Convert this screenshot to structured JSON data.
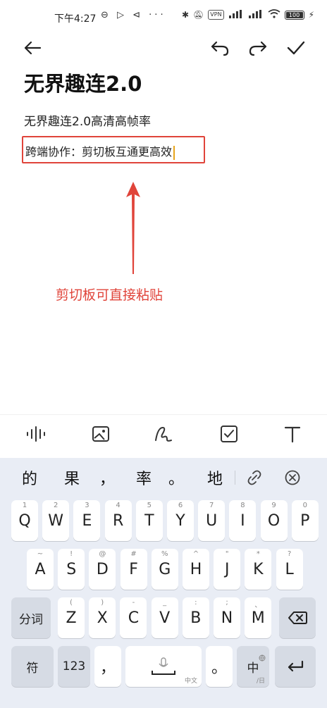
{
  "status_bar": {
    "time": "下午4:27",
    "vpn": "VPN",
    "battery": "100"
  },
  "note": {
    "title": "无界趣连2.0",
    "line1": "无界趣连2.0高清高帧率",
    "line2": "跨端协作：剪切板互通更高效",
    "annotation": "剪切板可直接粘贴"
  },
  "candidates": [
    "的",
    "果",
    "，",
    "率",
    "。",
    "地"
  ],
  "keyboard": {
    "row1": [
      {
        "k": "Q",
        "h": "1"
      },
      {
        "k": "W",
        "h": "2"
      },
      {
        "k": "E",
        "h": "3"
      },
      {
        "k": "R",
        "h": "4"
      },
      {
        "k": "T",
        "h": "5"
      },
      {
        "k": "Y",
        "h": "6"
      },
      {
        "k": "U",
        "h": "7"
      },
      {
        "k": "I",
        "h": "8"
      },
      {
        "k": "O",
        "h": "9"
      },
      {
        "k": "P",
        "h": "0"
      }
    ],
    "row2": [
      {
        "k": "A",
        "h": "~"
      },
      {
        "k": "S",
        "h": "!"
      },
      {
        "k": "D",
        "h": "@"
      },
      {
        "k": "F",
        "h": "#"
      },
      {
        "k": "G",
        "h": "%"
      },
      {
        "k": "H",
        "h": "^"
      },
      {
        "k": "J",
        "h": "\""
      },
      {
        "k": "K",
        "h": "*"
      },
      {
        "k": "L",
        "h": "?"
      }
    ],
    "row3": [
      {
        "k": "Z",
        "h": "("
      },
      {
        "k": "X",
        "h": ")"
      },
      {
        "k": "C",
        "h": "-"
      },
      {
        "k": "V",
        "h": "_"
      },
      {
        "k": "B",
        "h": ":"
      },
      {
        "k": "N",
        "h": ";"
      },
      {
        "k": "M",
        "h": "、"
      }
    ],
    "fenci": "分词",
    "symbol": "符",
    "num": "123",
    "comma": "，",
    "space_sub": "中文",
    "period": "。",
    "lang": "中",
    "lang_sub": "/日"
  }
}
